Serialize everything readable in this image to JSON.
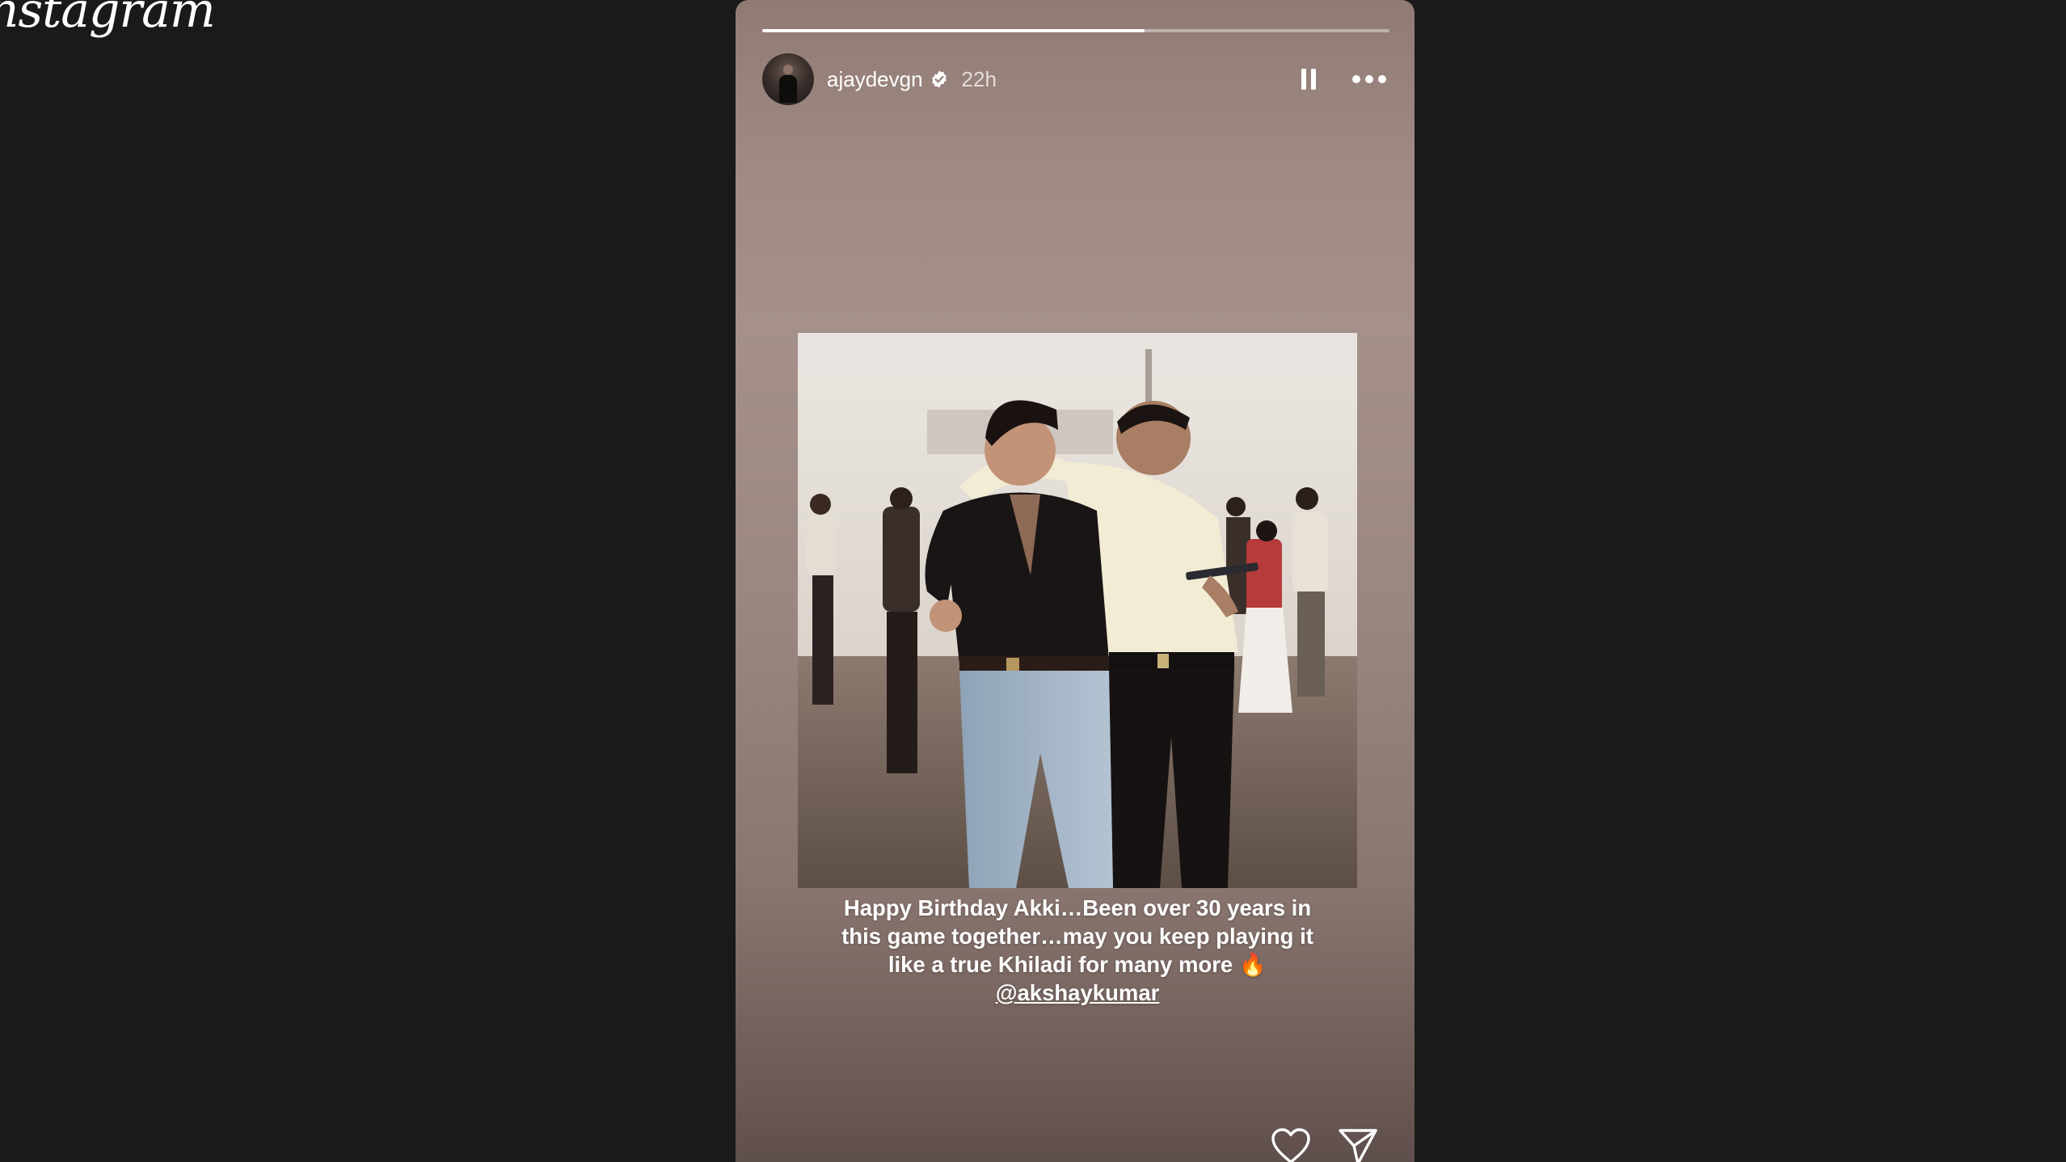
{
  "app": {
    "logo_text": "Instagram"
  },
  "story": {
    "username": "ajaydevgn",
    "verified": true,
    "time_ago": "22h",
    "progress_fraction": 0.61,
    "caption_lines": [
      "Happy Birthday Akki…Been over 30 years in",
      "this game together…may you keep playing it",
      "like a true Khiladi for many more 🔥"
    ],
    "caption_mention": "@akshaykumar"
  },
  "icons": {
    "verified": "verified-badge-icon",
    "pause": "pause-icon",
    "more": "more-options-icon",
    "like": "heart-icon",
    "share": "send-icon"
  },
  "colors": {
    "page_background": "#1a1a1a",
    "story_background_top": "#a5908a",
    "story_background_bottom": "#5f4f4c",
    "verified_badge": "#ffffff",
    "text": "#ffffff"
  }
}
